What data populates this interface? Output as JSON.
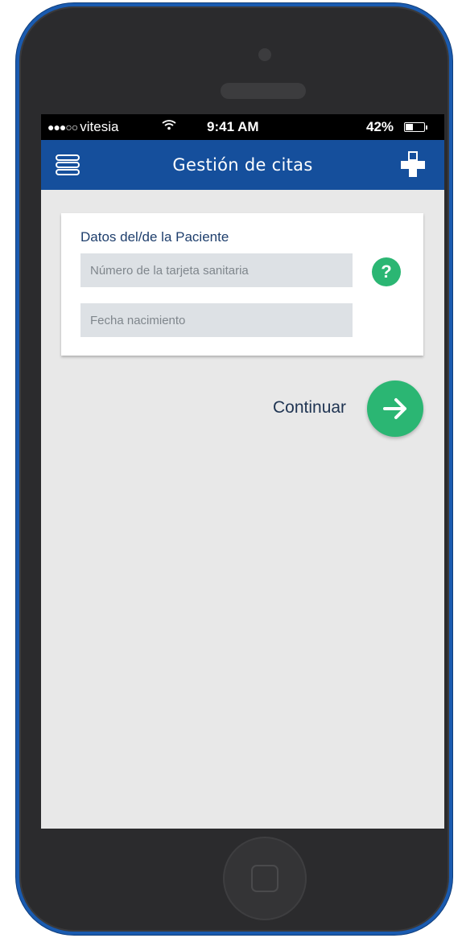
{
  "status_bar": {
    "signal_dots": "●●●○○",
    "carrier": "vitesia",
    "wifi_icon": "wifi-icon",
    "time": "9:41 AM",
    "battery_percent": "42%",
    "battery_level": 0.42
  },
  "app_bar": {
    "title": "Gestión de citas",
    "menu_icon": "hamburger-menu-icon",
    "logo_icon": "health-cross-logo-icon",
    "background_color": "#154f9c"
  },
  "patient_form": {
    "title": "Datos del/de la Paciente",
    "card_number": {
      "placeholder": "Número de la tarjeta sanitaria",
      "value": ""
    },
    "birth_date": {
      "placeholder": "Fecha nacimiento",
      "value": ""
    },
    "help_label": "?",
    "help_icon": "question-mark-icon",
    "accent_color": "#2bb673"
  },
  "actions": {
    "continue_label": "Continuar",
    "continue_icon": "arrow-right-icon"
  },
  "colors": {
    "frame_accent": "#1a5bb0",
    "screen_background": "#e8e8e8",
    "field_background": "#dde1e5"
  }
}
